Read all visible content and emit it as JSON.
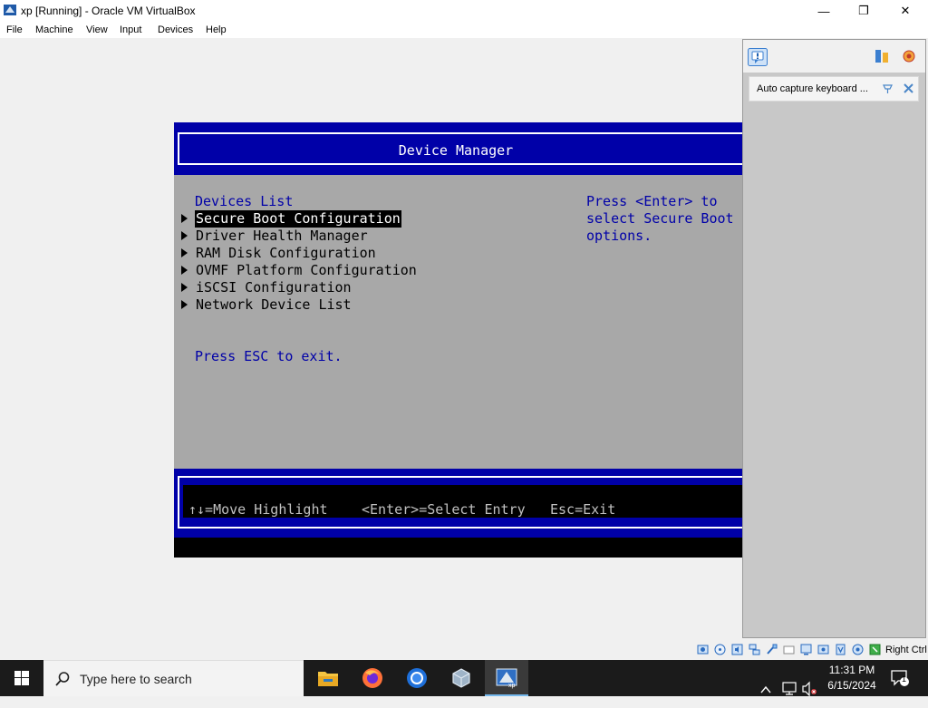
{
  "window": {
    "title": "xp [Running] - Oracle VM VirtualBox",
    "minimize_glyph": "—",
    "restore_glyph": "❐",
    "close_glyph": "✕"
  },
  "menu": [
    "File",
    "Machine",
    "View",
    "Input",
    "Devices",
    "Help"
  ],
  "vm_screen": {
    "header_title": "Device Manager",
    "section_title": "Devices List",
    "items": [
      "Secure Boot Configuration",
      "Driver Health Manager",
      "RAM Disk Configuration",
      "OVMF Platform Configuration",
      "iSCSI Configuration",
      "Network Device List"
    ],
    "selected_index": 0,
    "help_text": [
      "Press <Enter> to",
      "select Secure Boot",
      "options."
    ],
    "exit_hint": "Press ESC to exit.",
    "footer": {
      "move": "↑↓=Move Highlight",
      "select": "<Enter>=Select Entry",
      "exit": "Esc=Exit"
    },
    "colors": {
      "header_bg": "#0000a8",
      "body_bg": "#a8a8a8",
      "accent_text": "#0000a8"
    }
  },
  "notification": {
    "message": "Auto capture keyboard ...",
    "icons": [
      "info-icon",
      "settings-list-icon",
      "notifications-icon",
      "pin-icon",
      "close-icon"
    ]
  },
  "statusbar": {
    "icons": [
      "hard-disk-icon",
      "optical-drive-icon",
      "audio-icon",
      "network-icon",
      "usb-icon",
      "shared-folders-icon",
      "display-icon",
      "recording-icon",
      "cpu-icon",
      "mouse-integration-icon",
      "keyboard-icon"
    ],
    "host_key": "Right Ctrl"
  },
  "taskbar": {
    "search_placeholder": "Type here to search",
    "apps": [
      "file-explorer-icon",
      "firefox-icon",
      "chrome-icon",
      "virtualbox-icon",
      "vm-xp-icon"
    ],
    "time": "11:31 PM",
    "date": "6/15/2024",
    "notification_count": "1"
  }
}
